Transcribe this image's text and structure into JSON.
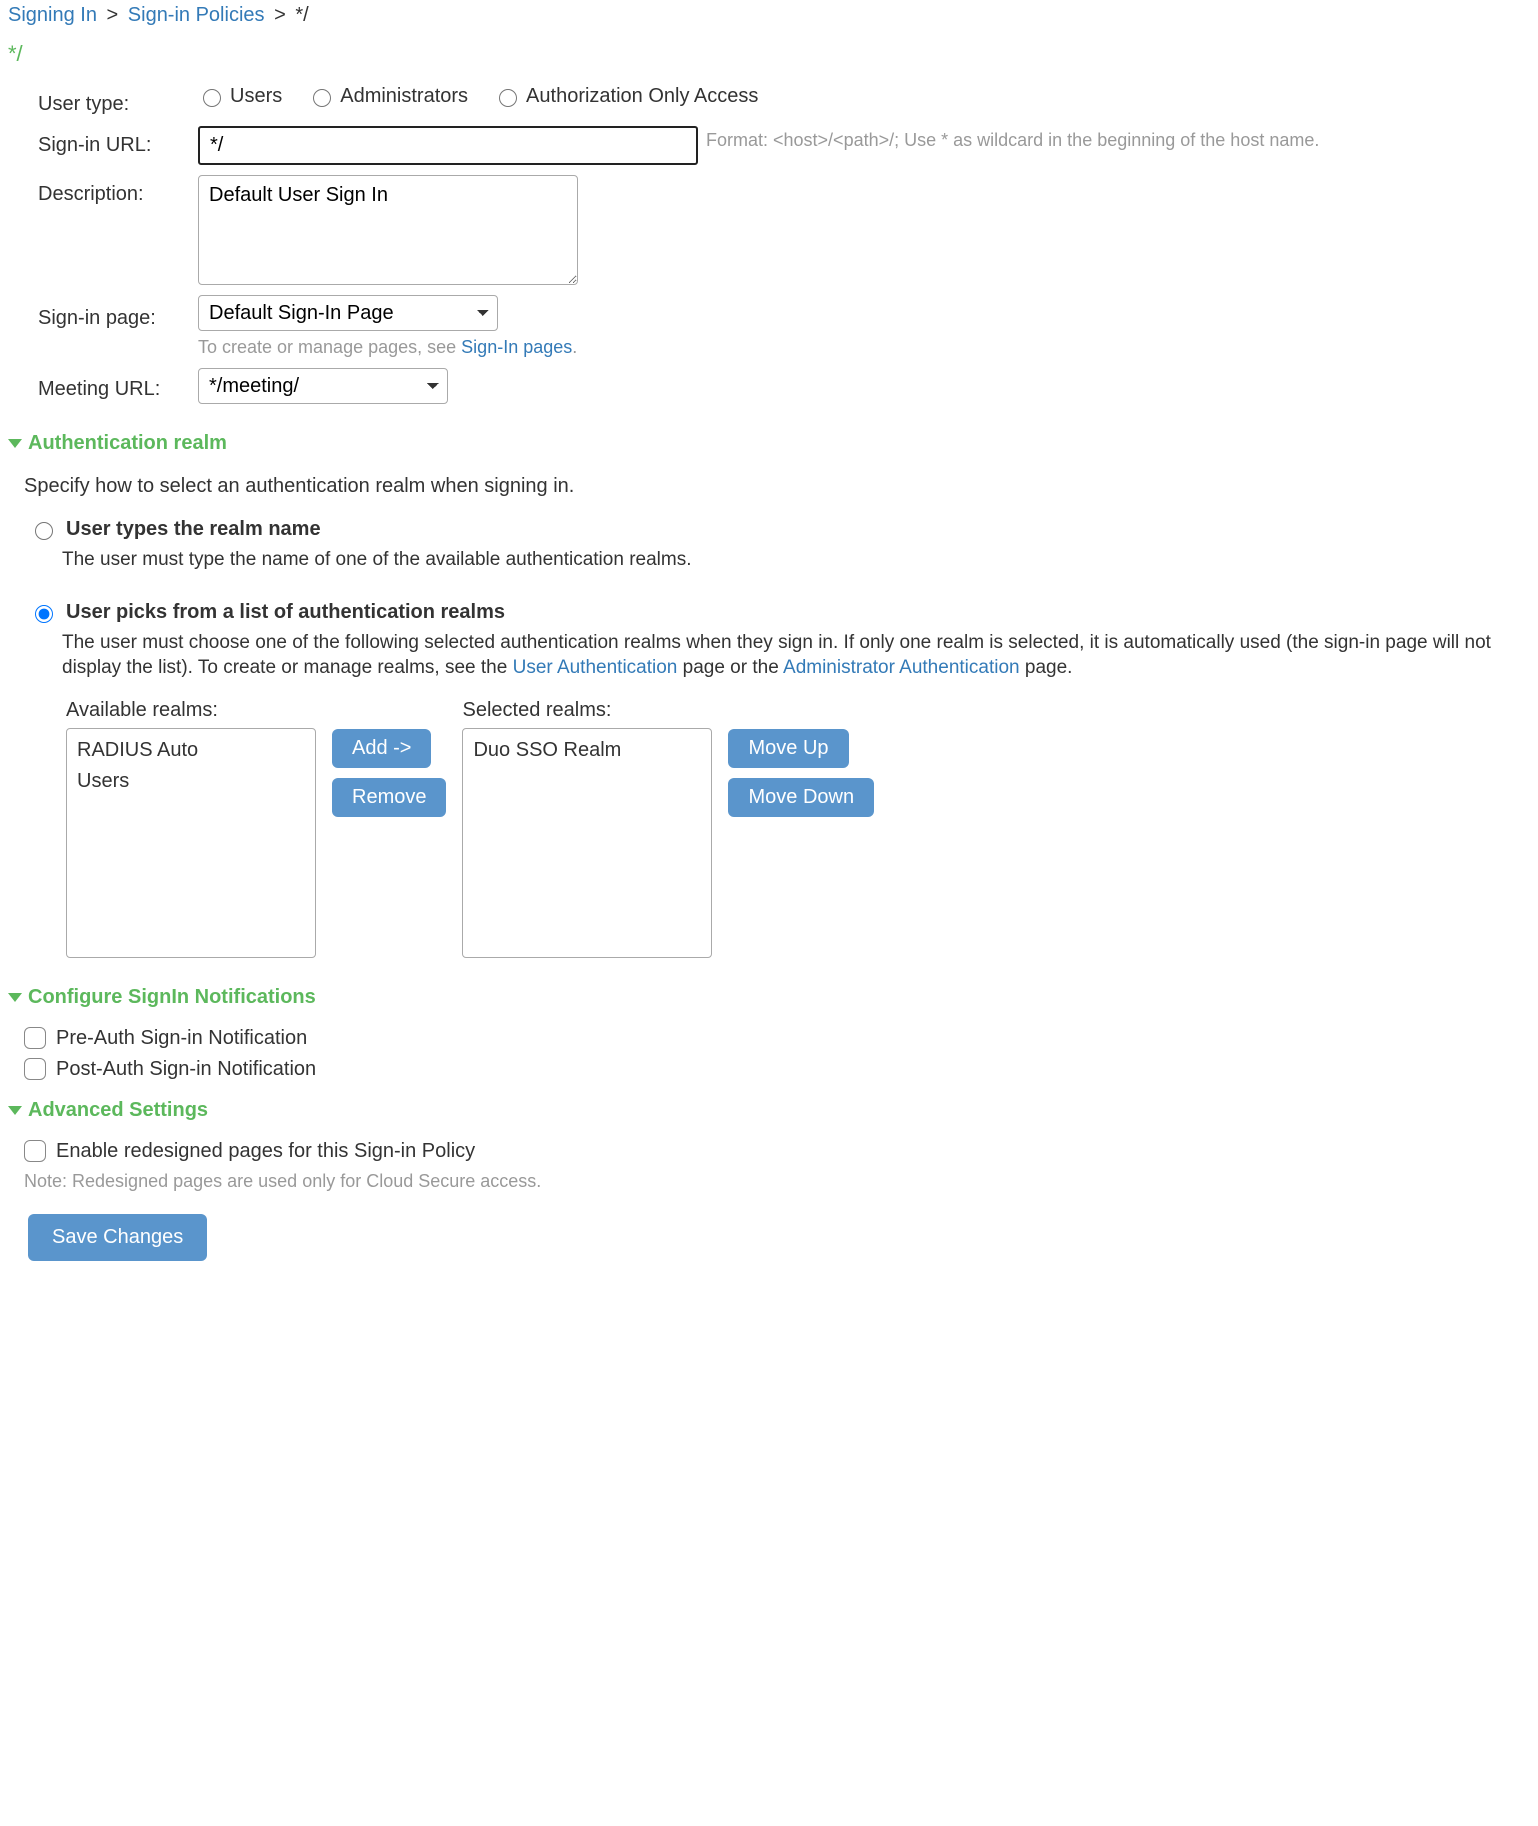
{
  "breadcrumb": {
    "l1": "Signing In",
    "l2": "Sign-in Policies",
    "tail": "*/"
  },
  "page_tag": "*/",
  "form": {
    "user_type_label": "User type:",
    "user_type_options": {
      "users": "Users",
      "admins": "Administrators",
      "authz": "Authorization Only Access"
    },
    "signin_url_label": "Sign-in URL:",
    "signin_url_value": "*/",
    "signin_url_hint": "Format: <host>/<path>/;   Use * as wildcard in the beginning of the host name.",
    "description_label": "Description:",
    "description_value": "Default User Sign In",
    "signin_page_label": "Sign-in page:",
    "signin_page_value": "Default Sign-In Page",
    "signin_page_hint_pre": "To create or manage pages, see ",
    "signin_page_hint_link": "Sign-In pages",
    "signin_page_hint_post": ".",
    "meeting_url_label": "Meeting URL:",
    "meeting_url_value": "*/meeting/"
  },
  "auth_realm": {
    "title": "Authentication realm",
    "intro": "Specify how to select an authentication realm when signing in.",
    "opt1_label": "User types the realm name",
    "opt1_desc": "The user must type the name of one of the available authentication realms.",
    "opt2_label": "User picks from a list of authentication realms",
    "opt2_desc_pre": "The user must choose one of the following selected authentication realms when they sign in. If only one realm is selected, it is automatically used (the sign-in page will not display the list). To create or manage realms, see the ",
    "opt2_desc_link1": "User Authentication",
    "opt2_desc_mid": " page or the ",
    "opt2_desc_link2": "Administrator Authentication",
    "opt2_desc_post": " page.",
    "available_label": "Available realms:",
    "selected_label": "Selected realms:",
    "available": [
      "RADIUS Auto",
      "Users"
    ],
    "selected": [
      "Duo SSO Realm"
    ],
    "btn_add": "Add ->",
    "btn_remove": "Remove",
    "btn_moveup": "Move Up",
    "btn_movedown": "Move Down"
  },
  "signin_notifications": {
    "title": "Configure SignIn Notifications",
    "pre_auth": "Pre-Auth Sign-in Notification",
    "post_auth": "Post-Auth Sign-in Notification"
  },
  "advanced": {
    "title": "Advanced Settings",
    "enable_redesigned": "Enable redesigned pages for this Sign-in Policy",
    "note": "Note: Redesigned pages are used only for Cloud Secure access."
  },
  "save_label": "Save Changes"
}
